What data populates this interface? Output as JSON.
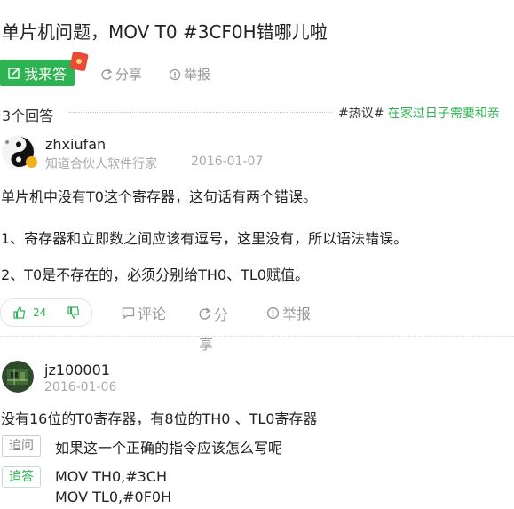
{
  "question": {
    "title": "单片机问题，MOV T0 #3CF0H错哪儿啦",
    "answer_button": "我来答",
    "share": "分享",
    "report": "举报"
  },
  "answers_header": {
    "count": "3个回答",
    "topic_tag": "#热议#",
    "topic_text": "在家过日子需要和亲"
  },
  "answer1": {
    "username": "zhxiufan",
    "subtitle": "知道合伙人软件行家",
    "date": "2016-01-07",
    "paragraphs": [
      "单片机中没有T0这个寄存器，这句话有两个错误。",
      "1、寄存器和立即数之间应该有逗号，这里没有，所以语法错误。",
      "2、T0是不存在的，必须分别给TH0、TL0赋值。"
    ],
    "likes": "24",
    "comment": "评论",
    "share_1": "分",
    "share_2": "享",
    "report": "举报"
  },
  "answer2": {
    "username": "jz100001",
    "date": "2016-01-06",
    "body": "没有16位的T0寄存器，有8位的TH0 、TL0寄存器",
    "followup_tag": "追问",
    "followup_text": "如果这一个正确的指令应该怎么写呢",
    "reply_tag": "追答",
    "reply_line1": "MOV TH0,#3CH",
    "reply_line2": "MOV TL0,#0F0H"
  },
  "colors": {
    "brand_green": "#2eb352",
    "muted": "#999999"
  }
}
